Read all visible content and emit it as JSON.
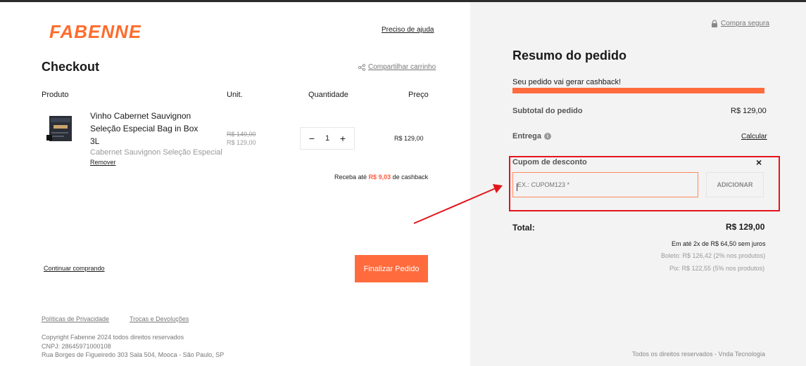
{
  "brand": {
    "logo_text": "FABENNE!",
    "color": "#ff6b2c"
  },
  "header": {
    "help_link": "Preciso de ajuda"
  },
  "checkout": {
    "title": "Checkout",
    "share_label": "Compartilhar carrinho",
    "columns": {
      "product": "Produto",
      "unit": "Unit.",
      "quantity": "Quantidade",
      "price": "Preço"
    },
    "item": {
      "name": "Vinho Cabernet Sauvignon Seleção Especial Bag in Box 3L",
      "description": "Cabernet Sauvignon Seleção Especial",
      "remove_label": "Remover",
      "old_unit_price": "R$ 149,00",
      "unit_price": "R$ 129,00",
      "quantity": "1",
      "price": "R$ 129,00"
    },
    "cashback": {
      "prefix": "Receba até",
      "amount": "R$ 9,03",
      "suffix": "de cashback"
    },
    "continue_label": "Continuar comprando",
    "finalize_label": "Finalizar Pedido"
  },
  "footer": {
    "privacy": "Políticas de Privacidade",
    "returns": "Trocas e Devoluções",
    "copyright": "Copyright Fabenne 2024 todos direitos reservados",
    "cnpj": "CNPJ: 28645971000108",
    "address": "Rua Borges de Figueiredo 303 Sala 504, Mooca - São Paulo, SP"
  },
  "summary": {
    "secure_label": "Compra segura",
    "title": "Resumo do pedido",
    "cashback_message": "Seu pedido vai gerar cashback!",
    "cashback_progress": 1.0,
    "subtotal_label": "Subtotal do pedido",
    "subtotal_value": "R$ 129,00",
    "shipping_label": "Entrega",
    "shipping_action": "Calcular",
    "coupon_label": "Cupom de desconto",
    "coupon_close": "×",
    "coupon_placeholder": "EX.: CUPOM123 *",
    "coupon_value": "",
    "coupon_button": "ADICIONAR",
    "total_label": "Total:",
    "total_value": "R$ 129,00",
    "installments": "Em até 2x de R$ 64,50 sem juros",
    "boleto": "Boleto: R$ 126,42 (2% nos produtos)",
    "pix": "Pix: R$ 122,55 (5% nos produtos)",
    "rights": "Todos os direitos reservados - Vnda Tecnologia"
  },
  "colors": {
    "accent": "#ff6b3d",
    "highlight": "#e4141b",
    "panel": "#f3f3f3"
  }
}
